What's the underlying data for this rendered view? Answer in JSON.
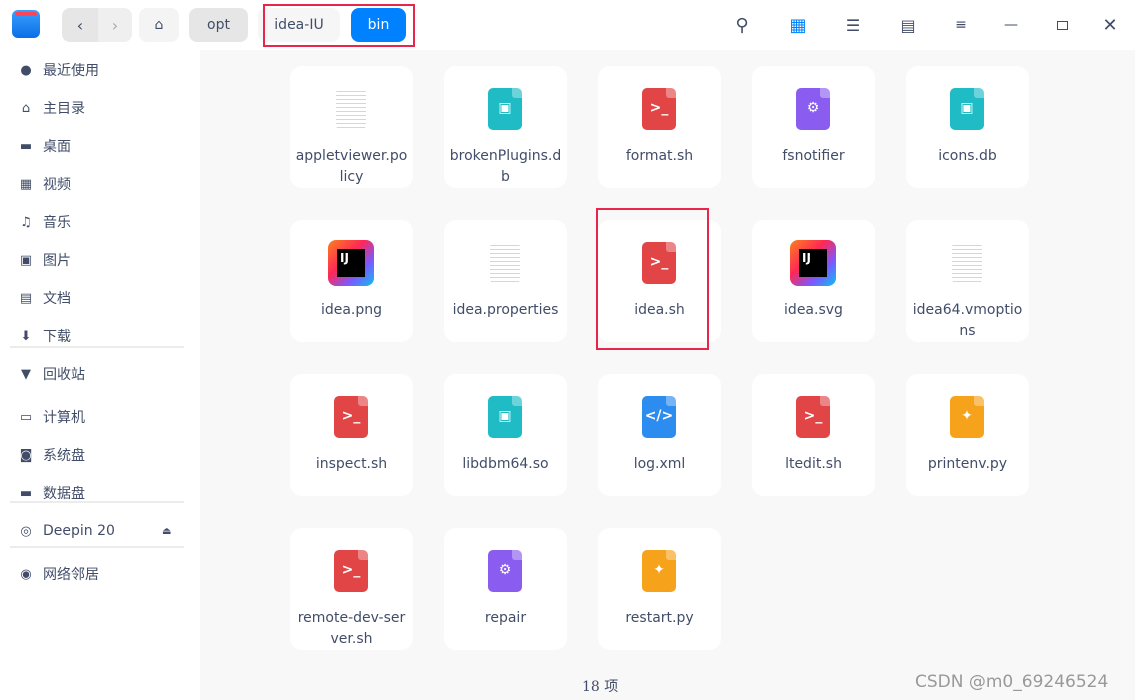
{
  "breadcrumb": [
    "opt",
    "idea-IU",
    "bin"
  ],
  "sidebar": {
    "items": [
      {
        "label": "最近使用",
        "icon": "clock-icon",
        "g": "●"
      },
      {
        "label": "主目录",
        "icon": "home-icon",
        "g": "⌂"
      },
      {
        "label": "桌面",
        "icon": "desktop-icon",
        "g": "▬"
      },
      {
        "label": "视频",
        "icon": "video-icon",
        "g": "▦"
      },
      {
        "label": "音乐",
        "icon": "music-icon",
        "g": "♫"
      },
      {
        "label": "图片",
        "icon": "picture-icon",
        "g": "▣"
      },
      {
        "label": "文档",
        "icon": "document-icon",
        "g": "▤"
      },
      {
        "label": "下载",
        "icon": "download-icon",
        "g": "⬇"
      },
      {
        "label": "回收站",
        "icon": "trash-icon",
        "g": "▼"
      },
      {
        "label": "计算机",
        "icon": "computer-icon",
        "g": "▭"
      },
      {
        "label": "系统盘",
        "icon": "system-disk-icon",
        "g": "◙"
      },
      {
        "label": "数据盘",
        "icon": "data-disk-icon",
        "g": "▬"
      },
      {
        "label": "Deepin 20",
        "icon": "disc-icon",
        "g": "◎"
      },
      {
        "label": "网络邻居",
        "icon": "network-icon",
        "g": "◉"
      }
    ]
  },
  "files": [
    {
      "name": "appletviewer.policy",
      "type": "text"
    },
    {
      "name": "brokenPlugins.db",
      "type": "db"
    },
    {
      "name": "format.sh",
      "type": "sh"
    },
    {
      "name": "fsnotifier",
      "type": "exec"
    },
    {
      "name": "icons.db",
      "type": "db"
    },
    {
      "name": "idea.png",
      "type": "ij"
    },
    {
      "name": "idea.properties",
      "type": "text"
    },
    {
      "name": "idea.sh",
      "type": "sh"
    },
    {
      "name": "idea.svg",
      "type": "ij"
    },
    {
      "name": "idea64.vmoptions",
      "type": "text"
    },
    {
      "name": "inspect.sh",
      "type": "sh"
    },
    {
      "name": "libdbm64.so",
      "type": "db"
    },
    {
      "name": "log.xml",
      "type": "xml"
    },
    {
      "name": "ltedit.sh",
      "type": "sh"
    },
    {
      "name": "printenv.py",
      "type": "py"
    },
    {
      "name": "remote-dev-server.sh",
      "type": "sh"
    },
    {
      "name": "repair",
      "type": "exec"
    },
    {
      "name": "restart.py",
      "type": "py"
    }
  ],
  "status": "18 项",
  "watermark": "CSDN @m0_69246524",
  "colors": {
    "accent": "#0081ff",
    "highlight": "#e8254a",
    "sh": "#e24545",
    "db": "#1fbcc6",
    "exec": "#8a5cf0",
    "xml": "#2d8cf0",
    "py": "#f6a21a"
  }
}
